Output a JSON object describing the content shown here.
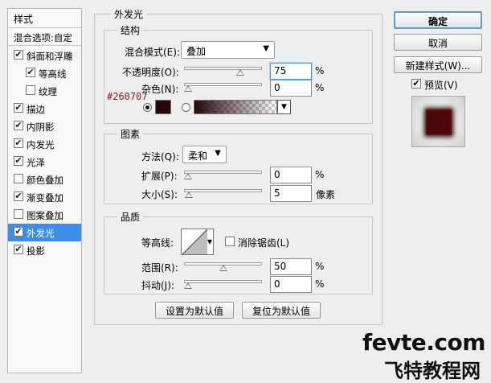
{
  "styles_panel": {
    "header": "样式",
    "blend_options": "混合选项:自定",
    "items": [
      {
        "label": "斜面和浮雕",
        "checked": true,
        "indent": false,
        "active": false
      },
      {
        "label": "等高线",
        "checked": true,
        "indent": true,
        "active": false
      },
      {
        "label": "纹理",
        "checked": false,
        "indent": true,
        "active": false
      },
      {
        "label": "描边",
        "checked": true,
        "indent": false,
        "active": false
      },
      {
        "label": "内阴影",
        "checked": true,
        "indent": false,
        "active": false
      },
      {
        "label": "内发光",
        "checked": true,
        "indent": false,
        "active": false
      },
      {
        "label": "光泽",
        "checked": true,
        "indent": false,
        "active": false
      },
      {
        "label": "颜色叠加",
        "checked": false,
        "indent": false,
        "active": false
      },
      {
        "label": "渐变叠加",
        "checked": true,
        "indent": false,
        "active": false
      },
      {
        "label": "图案叠加",
        "checked": false,
        "indent": false,
        "active": false
      },
      {
        "label": "外发光",
        "checked": true,
        "indent": false,
        "active": true
      },
      {
        "label": "投影",
        "checked": true,
        "indent": false,
        "active": false
      }
    ]
  },
  "outer_glow": {
    "title": "外发光",
    "structure": {
      "title": "结构",
      "blend_mode_label": "混合模式(E):",
      "blend_mode_value": "叠加",
      "opacity_label": "不透明度(O):",
      "opacity_value": "75",
      "opacity_fraction": 0.75,
      "noise_label": "杂色(N):",
      "noise_value": "0",
      "noise_fraction": 0,
      "percent": "%",
      "color_hex": "#260707",
      "color_radio_selected": true
    },
    "elements": {
      "title": "图素",
      "technique_label": "方法(Q):",
      "technique_value": "柔和",
      "spread_label": "扩展(P):",
      "spread_value": "0",
      "spread_fraction": 0,
      "size_label": "大小(S):",
      "size_value": "5",
      "size_unit": "像素",
      "percent": "%"
    },
    "quality": {
      "title": "品质",
      "contour_label": "等高线:",
      "antialias_label": "消除锯齿(L)",
      "antialias_checked": false,
      "range_label": "范围(R):",
      "range_value": "50",
      "range_fraction": 0.5,
      "jitter_label": "抖动(J):",
      "jitter_value": "0",
      "jitter_fraction": 0,
      "percent": "%"
    },
    "make_default": "设置为默认值",
    "reset_default": "复位为默认值"
  },
  "right_panel": {
    "ok": "确定",
    "cancel": "取消",
    "new_style": "新建样式(W)...",
    "preview_label": "预览(V)",
    "preview_checked": true
  },
  "watermark": {
    "line1": "fevte.com",
    "line2": "飞特教程网"
  },
  "colors": {
    "active_item": "#3b8fe6",
    "glow_color": "#260707",
    "preview_swatch": "#4a0808"
  }
}
